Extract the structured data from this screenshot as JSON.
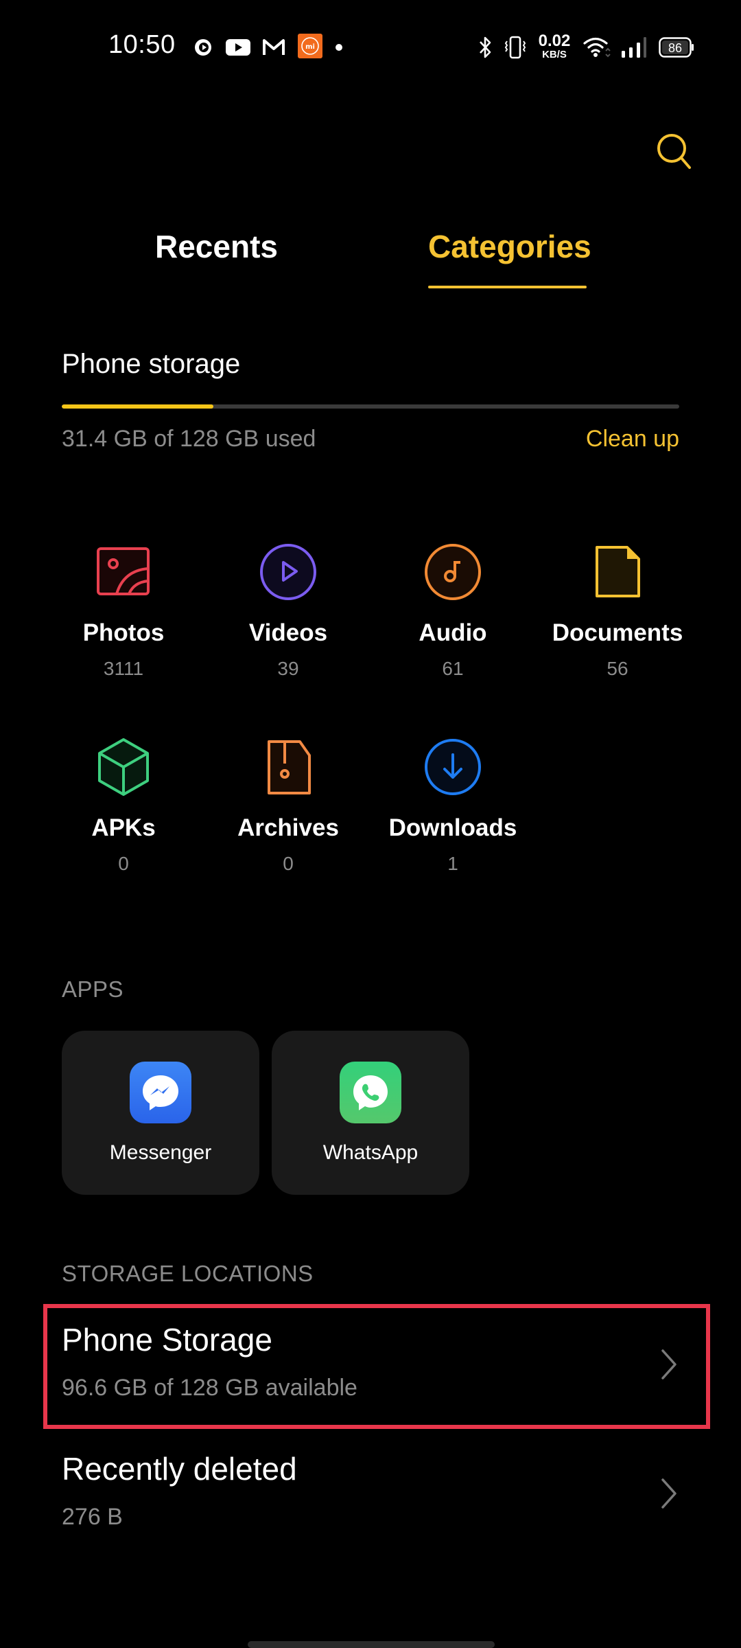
{
  "status_bar": {
    "time": "10:50",
    "notification_icons": [
      "recorder-icon",
      "youtube-icon",
      "gmail-icon",
      "mi-app-icon",
      "more-dot-icon"
    ],
    "system_icons": [
      "bluetooth-icon",
      "vibrate-icon",
      "wifi-icon",
      "signal-icon",
      "battery-icon"
    ],
    "network_speed_value": "0.02",
    "network_speed_unit": "KB/S",
    "battery_level": "86"
  },
  "header": {
    "search_icon": "search-icon",
    "tabs": [
      {
        "label": "Recents",
        "active": false
      },
      {
        "label": "Categories",
        "active": true
      }
    ],
    "accent_color": "#f5c232"
  },
  "storage_summary": {
    "title": "Phone storage",
    "used_text": "31.4 GB of 128 GB used",
    "used_fraction": 0.245,
    "cleanup_label": "Clean up"
  },
  "categories": [
    {
      "name": "Photos",
      "count": "3111",
      "icon": "photo-icon",
      "color": "#e8404f"
    },
    {
      "name": "Videos",
      "count": "39",
      "icon": "play-circle-icon",
      "color": "#7b5cf0"
    },
    {
      "name": "Audio",
      "count": "61",
      "icon": "music-note-icon",
      "color": "#f28a34"
    },
    {
      "name": "Documents",
      "count": "56",
      "icon": "document-icon",
      "color": "#f5c232"
    },
    {
      "name": "APKs",
      "count": "0",
      "icon": "cube-icon",
      "color": "#3ecf7f"
    },
    {
      "name": "Archives",
      "count": "0",
      "icon": "archive-icon",
      "color": "#f28a44"
    },
    {
      "name": "Downloads",
      "count": "1",
      "icon": "download-icon",
      "color": "#1e7cf2"
    }
  ],
  "apps": {
    "label": "APPS",
    "items": [
      {
        "name": "Messenger",
        "icon": "messenger-icon",
        "color": "#2f6ff0"
      },
      {
        "name": "WhatsApp",
        "icon": "whatsapp-icon",
        "color": "#3ccf72"
      }
    ]
  },
  "storage_locations": {
    "label": "STORAGE LOCATIONS",
    "items": [
      {
        "title": "Phone Storage",
        "subtitle": "96.6 GB of 128 GB available",
        "highlighted": true
      },
      {
        "title": "Recently deleted",
        "subtitle": "276 B",
        "highlighted": false
      }
    ],
    "highlight_color": "#e8364b"
  }
}
